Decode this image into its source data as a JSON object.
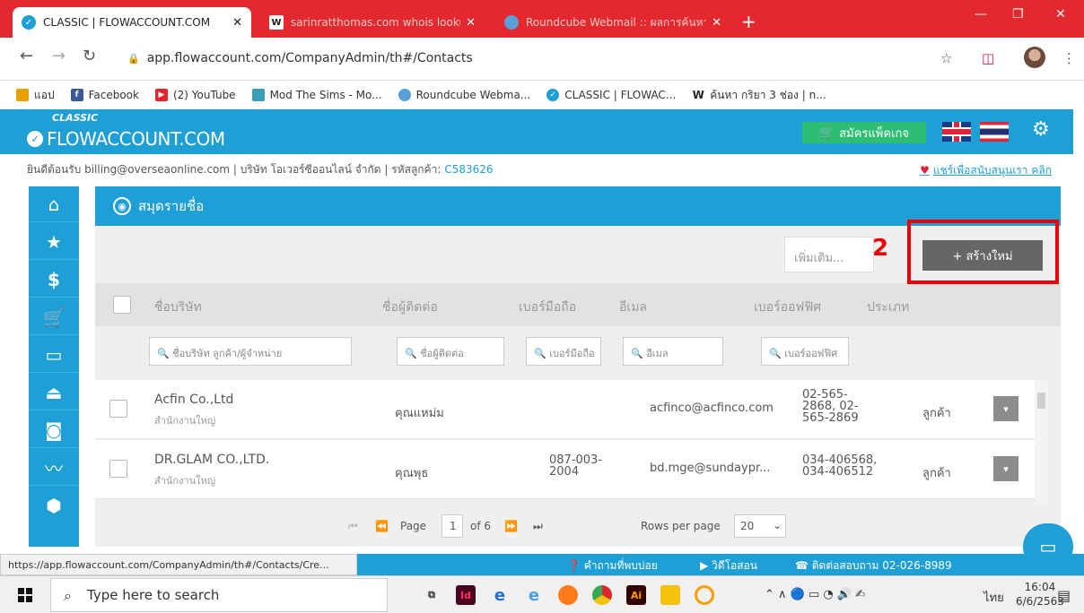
{
  "browser": {
    "tabs": [
      {
        "title": "CLASSIC | FLOWACCOUNT.COM",
        "active": true
      },
      {
        "title": "sarinratthomas.com whois lookup",
        "active": false
      },
      {
        "title": "Roundcube Webmail :: ผลการค้นหา",
        "active": false
      }
    ],
    "new_tab": "+",
    "url": "app.flowaccount.com/CompanyAdmin/th#/Contacts",
    "bookmarks": [
      {
        "label": "แอป",
        "color": "#e8a000"
      },
      {
        "label": "Facebook",
        "color": "#3b5998"
      },
      {
        "label": "(2) YouTube",
        "color": "#e0262a"
      },
      {
        "label": "Mod The Sims - Mo...",
        "color": "#3aa0b8"
      },
      {
        "label": "Roundcube Webma...",
        "color": "#5aa0d8"
      },
      {
        "label": "CLASSIC | FLOWAC...",
        "color": "#1e9fd6"
      },
      {
        "label": "ค้นหา กริยา 3 ช่อง | n...",
        "color": "#ffffff"
      }
    ]
  },
  "app": {
    "logo_classic": "CLASSIC",
    "logo": "FLOWACCOUNT.COM",
    "signup_label": "สมัครแพ็คเกจ",
    "welcome_text": "ยินดีต้อนรับ billing@overseaonline.com | บริษัท โอเวอร์ซีออนไลน์ จำกัด | รหัสลูกค้า:",
    "customer_code": "C583626",
    "support_link": "แชร์เพื่อสนับสนุนเรา คลิก",
    "panel_title": "สมุดรายชื่อ",
    "more_placeholder": "เพิ่มเติม...",
    "new_button": "+ สร้างใหม่",
    "annotation_number": "2",
    "columns": [
      "ชื่อบริษัท",
      "ชื่อผู้ติดต่อ",
      "เบอร์มือถือ",
      "อีเมล",
      "เบอร์ออฟฟิศ",
      "ประเภท"
    ],
    "filters": [
      "ชื่อบริษัท ลูกค้า/ผู้จำหน่าย",
      "ชื่อผู้ติดต่อ",
      "เบอร์มือถือ",
      "อีเมล",
      "เบอร์ออฟฟิศ"
    ],
    "rows": [
      {
        "company": "Acfin Co.,Ltd",
        "branch": "สำนักงานใหญ่",
        "contact": "คุณแหม่ม",
        "mobile": "",
        "email": "acfinco@acfinco.com",
        "office": "02-565-\n2868, 02-\n565-2869",
        "type": "ลูกค้า"
      },
      {
        "company": "DR.GLAM CO.,LTD.",
        "branch": "สำนักงานใหญ่",
        "contact": "คุณพุธ",
        "mobile": "087-003-\n2004",
        "email": "bd.mge@sundaypr...",
        "office": "034-406568,\n034-406512",
        "type": "ลูกค้า"
      }
    ],
    "pager": {
      "page_label": "Page",
      "page": "1",
      "of": "of 6",
      "rows_label": "Rows per page",
      "rows": "20"
    },
    "footer": {
      "faq": "คำถามที่พบบ่อย",
      "video": "วิดีโอสอน",
      "contact": "ติดต่อสอบถาม 02-026-8989"
    },
    "status_url": "https://app.flowaccount.com/CompanyAdmin/th#/Contacts/Cre..."
  },
  "taskbar": {
    "search_placeholder": "Type here to search",
    "lang": "ไทย",
    "time": "16:04",
    "date": "6/6/2563"
  },
  "colors": {
    "brand": "#1e9fd6",
    "chrome_red": "#e4292e",
    "annotation": "#ee0000"
  }
}
